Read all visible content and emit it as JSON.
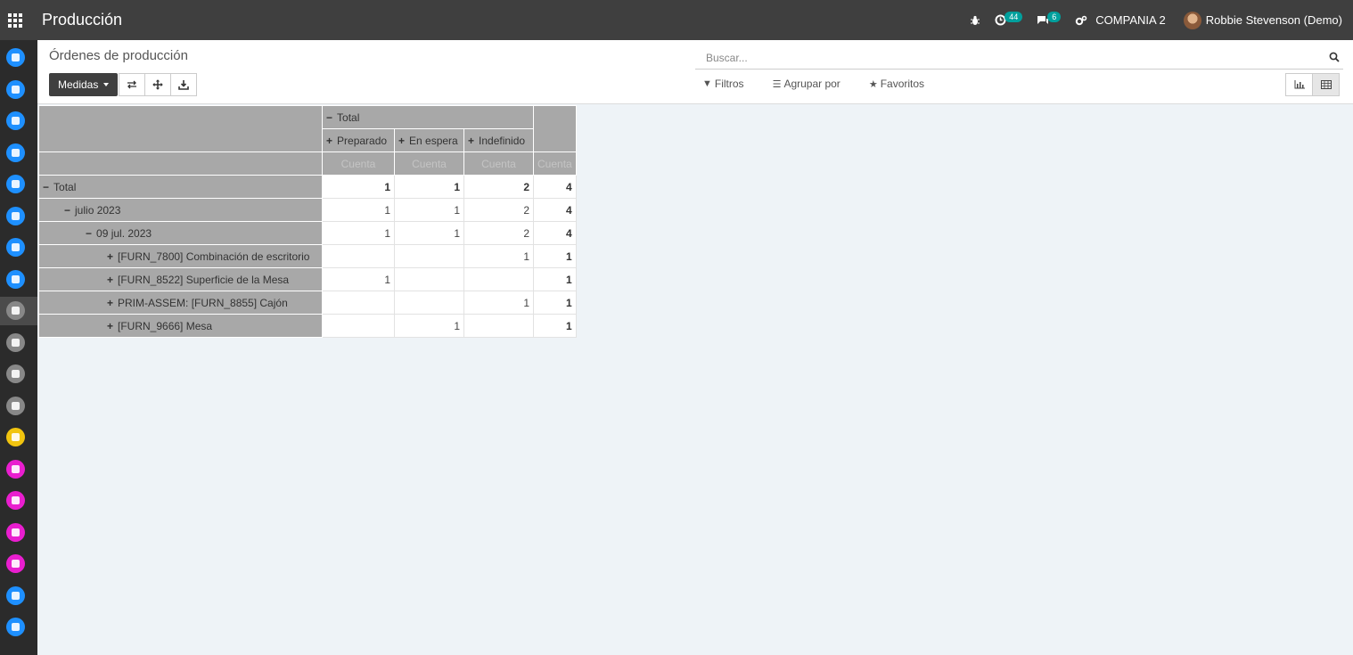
{
  "topbar": {
    "app_title": "Producción",
    "activity_count": "44",
    "messages_count": "6",
    "company": "COMPANIA 2",
    "user": "Robbie Stevenson (Demo)"
  },
  "control_panel": {
    "breadcrumb": "Órdenes de producción",
    "measures_label": "Medidas",
    "search_placeholder": "Buscar...",
    "filters_label": "Filtros",
    "group_by_label": "Agrupar por",
    "favorites_label": "Favoritos"
  },
  "pivot": {
    "col_total_header": "Total",
    "col_groups": [
      "Preparado",
      "En espera",
      "Indefinido"
    ],
    "measure_label": "Cuenta",
    "rows": [
      {
        "label": "Total",
        "values": [
          "1",
          "1",
          "2",
          "4"
        ]
      },
      {
        "label": "julio 2023",
        "values": [
          "1",
          "1",
          "2",
          "4"
        ]
      },
      {
        "label": "09 jul. 2023",
        "values": [
          "1",
          "1",
          "2",
          "4"
        ]
      },
      {
        "label": "[FURN_7800] Combinación de escritorio",
        "values": [
          "",
          "",
          "1",
          "1"
        ]
      },
      {
        "label": "[FURN_8522] Superficie de la Mesa",
        "values": [
          "1",
          "",
          "",
          "1"
        ]
      },
      {
        "label": "PRIM-ASSEM: [FURN_8855] Cajón",
        "values": [
          "",
          "",
          "1",
          "1"
        ]
      },
      {
        "label": "[FURN_9666] Mesa",
        "values": [
          "",
          "1",
          "",
          "1"
        ]
      }
    ]
  },
  "sidebar_icon_colors": [
    "#1e90ff",
    "#1e90ff",
    "#1e90ff",
    "#1e90ff",
    "#1e90ff",
    "#1e90ff",
    "#1e90ff",
    "#1e90ff",
    "#888888",
    "#888888",
    "#888888",
    "#888888",
    "#f1c40f",
    "#e91ecf",
    "#e91ecf",
    "#e91ecf",
    "#e91ecf",
    "#1e90ff",
    "#1e90ff"
  ]
}
